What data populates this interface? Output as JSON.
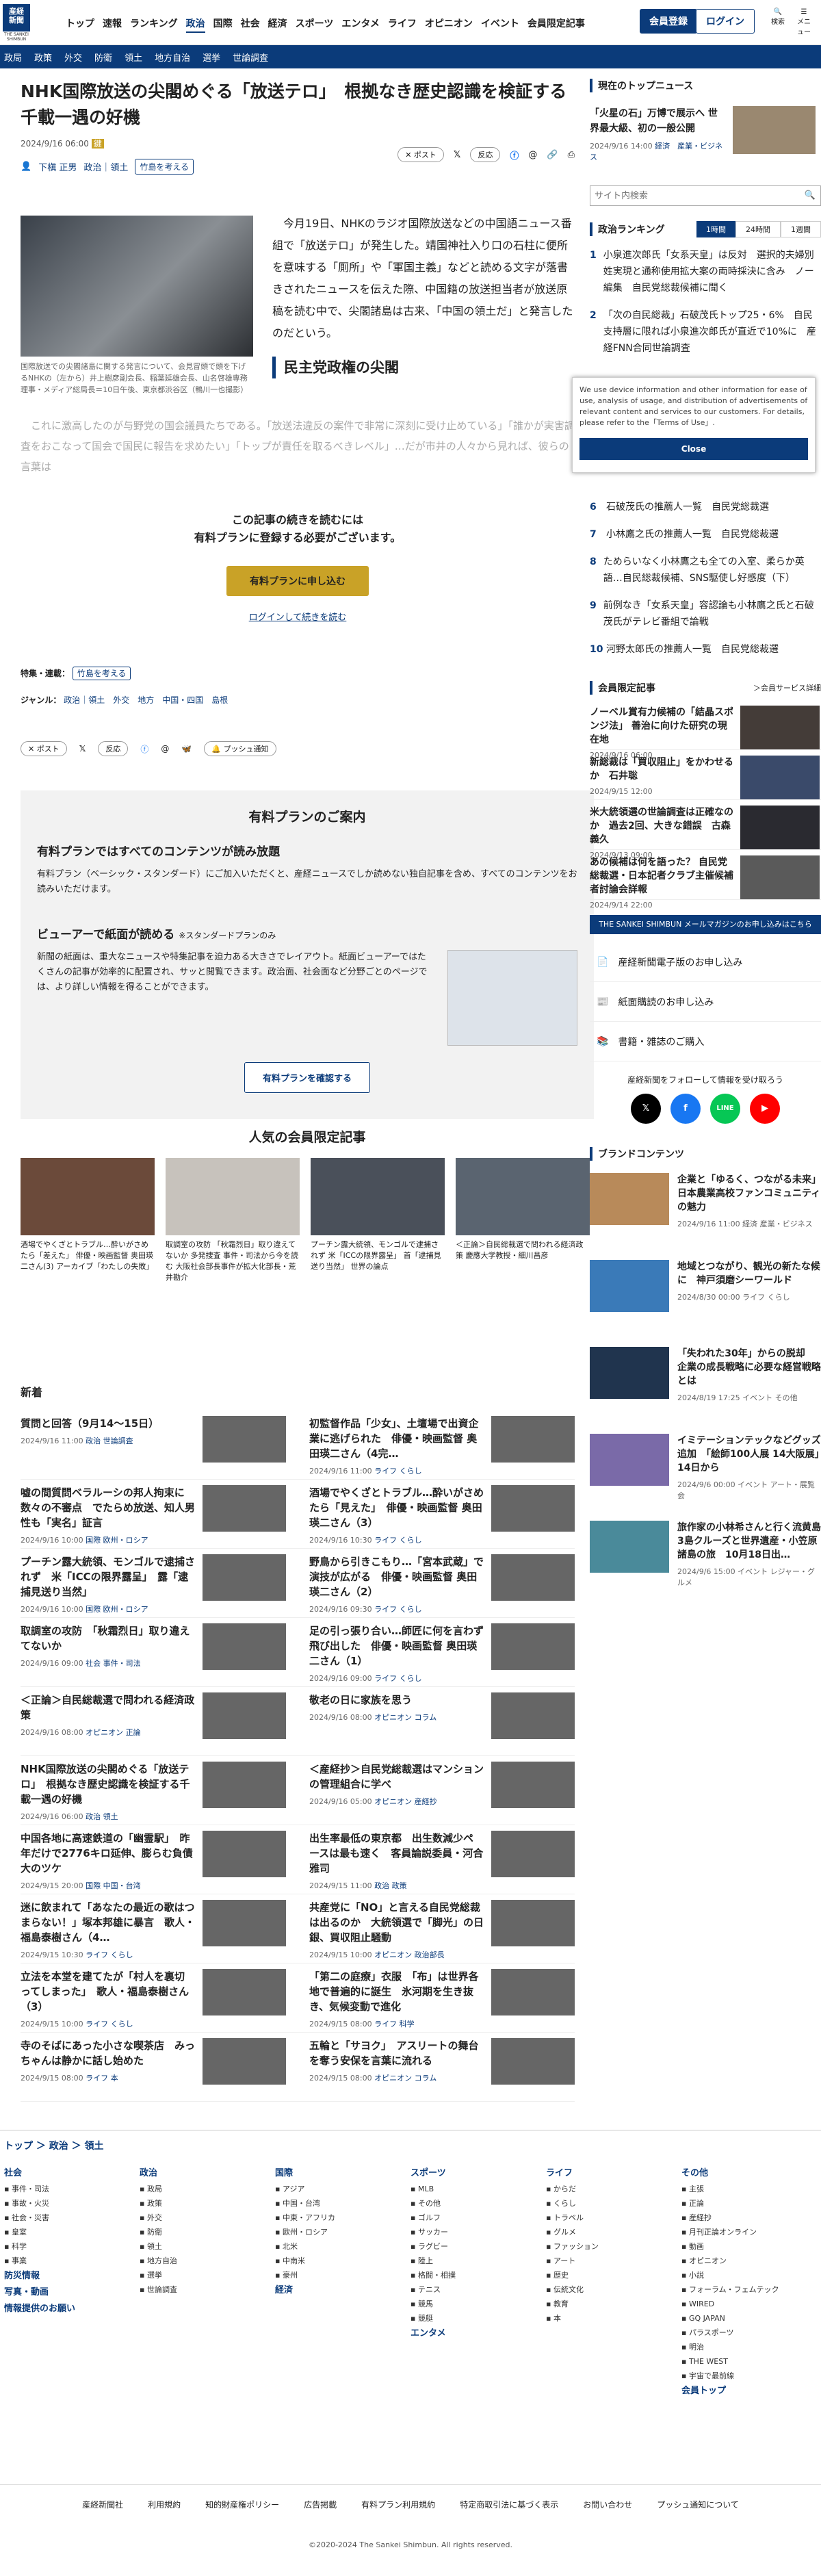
{
  "header": {
    "logo": "産経\n新聞",
    "logo_en": "THE SANKEI SHIMBUN",
    "nav": [
      "トップ",
      "速報",
      "ランキング",
      "政治",
      "国際",
      "社会",
      "経済",
      "スポーツ",
      "エンタメ",
      "ライフ",
      "オピニオン",
      "イベント",
      "会員限定記事"
    ],
    "register": "会員登録",
    "login": "ログイン",
    "search_label": "検索",
    "menu_label": "メニュー"
  },
  "subnav": [
    "政局",
    "政策",
    "外交",
    "防衛",
    "領土",
    "地方自治",
    "選挙",
    "世論調査"
  ],
  "article": {
    "title": "NHK国際放送の尖閣めぐる「放送テロ」　根拠なき歴史認識を検証する千載一遇の好機",
    "date": "2024/9/16 06:00",
    "author": "下槇 正男",
    "cats": "政治｜領土",
    "tag": "竹島を考える",
    "post": "ポスト",
    "report": "反応",
    "caption": "国際放送での尖閣諸島に関する発言について、会見冒頭で頭を下げるNHKの（左から）井上樹彦副会長、稲葉延雄会長、山名啓雄専務理事・メディア総局長＝10日午後、東京都渋谷区（鴨川一也撮影）",
    "body": "　今月19日、NHKのラジオ国際放送などの中国語ニュース番組で「放送テロ」が発生した。靖国神社入り口の石柱に便所を意味する「厠所」や「軍国主義」などと読める文字が落書きされたニュースを伝えた際、中国籍の放送担当者が放送原稿を読む中で、尖閣諸島は古来、「中国の領土だ」と発言したのだという。",
    "subhead": "民主党政権の尖閣",
    "fade": "　これに激高したのが与野党の国会議員たちである。「放送法違反の案件で非常に深刻に受け止めている」「誰かが実害調査をおこなって国会で国民に報告を求めたい」「トップが責任を取るべきレベル」…だが市井の人々から見れば、彼らの言葉は",
    "paywall1": "この記事の続きを読むには",
    "paywall2": "有料プランに登録する必要がございます。",
    "pw_button": "有料プランに申し込む",
    "pw_link": "ログインして続きを読む",
    "special_label": "特集・連載：",
    "special": "竹島を考える",
    "genre_label": "ジャンル：",
    "genres": "政治｜領土　外交　地方　中国・四国　島根",
    "push": "プッシュ通知"
  },
  "plan": {
    "title": "有料プランのご案内",
    "h1": "有料プランではすべてのコンテンツが読み放題",
    "p1": "有料プラン（ベーシック・スタンダード）にご加入いただくと、産経ニュースでしか読めない独自記事を含め、すべてのコンテンツをお読みいただけます。",
    "h2": "ビューアーで紙面が読める",
    "h2s": "※スタンダードプランのみ",
    "p2": "新聞の紙面は、重大なニュースや特集記事を迫力ある大きさでレイアウト。紙面ビューアーではたくさんの記事が効率的に配置され、サッと閲覧できます。政治面、社会面など分野ごとのページでは、より詳しい情報を得ることができます。",
    "button": "有料プランを確認する"
  },
  "popular": {
    "title": "人気の会員限定記事",
    "items": [
      "酒場でやくざとトラブル…酔いがさめたら「差えた」 俳優・映画監督 奥田瑛二さん(3) アーカイブ「わたしの失敗」",
      "取調室の攻防 「秋霜烈日」取り違えてないか 多発捜査 事件・司法から今を読む 大阪社会部長事件が拡大化部長・荒井勘介",
      "プーチン露大統領、モンゴルで逮捕されず 米「ICCの限界露呈」 首「逮捕見送り当然」 世界の論点",
      "＜正論＞自民総裁選で問われる経済政策 慶應大学教授・細川昌彦"
    ]
  },
  "news_title": "新着",
  "news": [
    [
      "質問と回答（9月14～15日）",
      "2024/9/16 11:00",
      "政治",
      "世論調査",
      "初監督作品「少女」、土壇場で出資企業に逃げられた　俳優・映画監督 奥田瑛二さん（4完…",
      "2024/9/16 11:00",
      "ライフ",
      "くらし"
    ],
    [
      "嘘の間質問ベラルーシの邦人拘束に数々の不審点　でたらめ放送、知人男性も「実名」証言",
      "2024/9/16 10:00",
      "国際",
      "欧州・ロシア",
      "酒場でやくざとトラブル…酔いがさめたら「見えた」　俳優・映画監督 奥田瑛二さん（3）",
      "2024/9/16 10:30",
      "ライフ",
      "くらし"
    ],
    [
      "プーチン露大統領、モンゴルで逮捕されず　米「ICCの限界露呈」　露「逮捕見送り当然」",
      "2024/9/16 10:00",
      "国際",
      "欧州・ロシア",
      "野鳥から引きこもり…「宮本武蔵」で演技が広がる　俳優・映画監督 奥田瑛二さん（2）",
      "2024/9/16 09:30",
      "ライフ",
      "くらし"
    ],
    [
      "取調室の攻防　「秋霜烈日」取り違えてないか",
      "2024/9/16 09:00",
      "社会",
      "事件・司法",
      "足の引っ張り合い…師匠に何を言わず飛び出した　俳優・映画監督 奥田瑛二さん（1）",
      "2024/9/16 09:00",
      "ライフ",
      "くらし"
    ],
    [
      "＜正論＞自民総裁選で問われる経済政策",
      "2024/9/16 08:00",
      "オピニオン",
      "正論",
      "敬老の日に家族を思う",
      "2024/9/16 08:00",
      "オピニオン",
      "コラム"
    ],
    [
      "NHK国際放送の尖閣めぐる「放送テロ」　根拠なき歴史認識を検証する千載一遇の好機",
      "2024/9/16 06:00",
      "政治",
      "領土",
      "＜産経抄＞自民党総裁選はマンションの管理組合に学べ",
      "2024/9/16 05:00",
      "オピニオン",
      "産経抄"
    ],
    [
      "中国各地に高速鉄道の「幽霊駅」　昨年だけで2776キロ延伸、膨らむ負債大のツケ",
      "2024/9/15 20:00",
      "国際",
      "中国・台湾",
      "出生率最低の東京都　出生数減少ペースは最も速く　客員論説委員・河合雅司",
      "2024/9/15 11:00",
      "政治",
      "政策"
    ],
    [
      "迷に飲まれて「あなたの最近の歌はつまらない！」塚本邦雄に暴言　歌人・福島泰樹さん（4…",
      "2024/9/15 10:30",
      "ライフ",
      "くらし",
      "共産党に「NO」と言える自民党総裁は出るのか　大統領選で「脚光」の日銀、買収阻止騒動",
      "2024/9/15 10:00",
      "オピニオン",
      "政治部長"
    ],
    [
      "立法を本堂を建てたが「村人を裏切ってしまった」　歌人・福島泰樹さん（3）",
      "2024/9/15 10:00",
      "ライフ",
      "くらし",
      "「第二の庭療」衣服　「布」は世界各地で普遍的に誕生　氷河期を生き抜き、気候変動で進化",
      "2024/9/15 08:00",
      "ライフ",
      "科学"
    ],
    [
      "寺のそばにあった小さな喫茶店　みっちゃんは静かに話し始めた",
      "2024/9/15 08:00",
      "ライフ",
      "本",
      "五輪と「サヨク」　アスリートの舞台を奪う安保を言葉に流れる",
      "2024/9/15 08:00",
      "オピニオン",
      "コラム"
    ]
  ],
  "breadcrumb": "トップ ＞ 政治 ＞ 領土",
  "sitemap": [
    {
      "h": "社会",
      "items": [
        "事件・司法",
        "事故・火災",
        "社会・災害",
        "皇室",
        "科学",
        "事業"
      ]
    },
    {
      "h": "政治",
      "items": [
        "政局",
        "政策",
        "外交",
        "防衛",
        "領土",
        "地方自治",
        "選挙",
        "世論調査"
      ]
    },
    {
      "h": "国際",
      "items": [
        "アジア",
        "中国・台湾",
        "中東・アフリカ",
        "欧州・ロシア",
        "北米",
        "中南米",
        "豪州"
      ]
    },
    {
      "h": "スポーツ",
      "items": [
        "MLB",
        "その他",
        "ゴルフ",
        "サッカー",
        "ラグビー",
        "陸上",
        "格闘・相撲",
        "テニス",
        "競馬",
        "競艇"
      ]
    },
    {
      "h": "ライフ",
      "items": [
        "からだ",
        "くらし",
        "トラベル",
        "グルメ",
        "ファッション",
        "アート",
        "歴史",
        "伝統文化",
        "教育",
        "本"
      ]
    },
    {
      "h": "その他",
      "items": [
        "主張",
        "正論",
        "産経抄",
        "月刊正論オンライン",
        "動画",
        "オピニオン",
        "小説",
        "フォーラム・フェムテック",
        "WIRED",
        "GQ JAPAN",
        "パラスポーツ",
        "明治",
        "THE WEST",
        "宇宙で最前線"
      ]
    }
  ],
  "sitemap_extra": [
    "防災情報",
    "写真・動画",
    "情報提供のお願い",
    "経済",
    "エンタメ",
    "会員トップ"
  ],
  "footer": {
    "links": [
      "産経新聞社",
      "利用規約",
      "知的財産権ポリシー",
      "広告掲載",
      "有料プラン利用規約",
      "特定商取引法に基づく表示",
      "お問い合わせ",
      "プッシュ通知について"
    ],
    "copyright": "©2020-2024 The Sankei Shimbun. All rights reserved."
  },
  "sidebar": {
    "top_title": "現在のトップニュース",
    "top_headline": "「火星の石」万博で展示へ 世界最大級、初の一般公開",
    "top_meta": "2024/9/16 14:00",
    "top_cats": "経済　産業・ビジネス",
    "search_placeholder": "サイト内検索",
    "rank_title": "政治ランキング",
    "rank_tabs": [
      "1時間",
      "24時間",
      "1週間"
    ],
    "ranks": [
      "小泉進次郎氏「女系天皇」は反対　選択的夫婦別姓実現と通称使用拡大案の両時採決に含み　ノー編集　自民党総裁候補に聞く",
      "「次の自民総裁」石破茂氏トップ25・6%　自民支持層に限れば小泉進次郎氏が直近で10%に　産経FNN合同世論調査",
      "",
      "",
      "",
      "石破茂氏の推薦人一覧　自民党総裁選",
      "小林鷹之氏の推薦人一覧　自民党総裁選",
      "ためらいなく小林鷹之も全ての入室、柔らか英語…自民総裁候補、SNS駆使し好感度（下）",
      "前例なき「女系天皇」容認論も小林鷹之氏と石破茂氏がテレビ番組で論戦",
      "河野太郎氏の推薦人一覧　自民党総裁選"
    ],
    "modal_text": "We use device information and other information for ease of use, analysis of usage, and distribution of advertisements of relevant content and services to our customers. For details, please refer to the「Terms of Use」.",
    "modal_close": "Close",
    "limited_title": "会員限定記事",
    "limited_link": "会員サービス詳細",
    "limited": [
      [
        "ノーベル賞有力候補の「結晶スポンジ法」 善治に向けた研究の現在地",
        "2024/9/16 06:00"
      ],
      [
        "新総裁は「買収阻止」をかわせるか　石井聡",
        "2024/9/15 12:00"
      ],
      [
        "米大統領選の世論調査は正確なのか　過去2回、大きな錯誤　古森義久",
        "2024/9/13 09:00"
      ],
      [
        "あの候補は何を語った？ 自民党総裁選・日本記者クラブ主催候補者討論会詳報",
        "2024/9/14 22:00"
      ]
    ],
    "banner": "THE SANKEI SHIMBUN メールマガジンのお申し込みはこちら",
    "services": [
      "産経新聞電子版のお申し込み",
      "紙面購読のお申し込み",
      "書籍・雑誌のご購入"
    ],
    "follow": "産経新聞をフォローして情報を受け取ろう",
    "brand_title": "ブランドコンテンツ",
    "brands": [
      [
        "企業と「ゆるく、つながる未来」 日本農業高校ファンコミュニティの魅力",
        "2024/9/16 11:00 経済 産業・ビジネス"
      ],
      [
        "地域とつながり、観光の新たな候に　神戸須磨シーワールド",
        "2024/8/30 00:00 ライフ くらし"
      ],
      [
        "「失われた30年」からの脱却　企業の成長戦略に必要な経営戦略とは",
        "2024/8/19 17:25 イベント その他"
      ],
      [
        "イミテーションテックなどグッズ追加　「絵師100人展 14大阪展」14日から",
        "2024/9/6 00:00 イベント アート・展覧会"
      ],
      [
        "旅作家の小林希さんと行く流黄島3島クルーズと世界遺産・小笠原諸島の旅　10月18日出…",
        "2024/9/6 15:00 イベント レジャー・グルメ"
      ]
    ]
  }
}
